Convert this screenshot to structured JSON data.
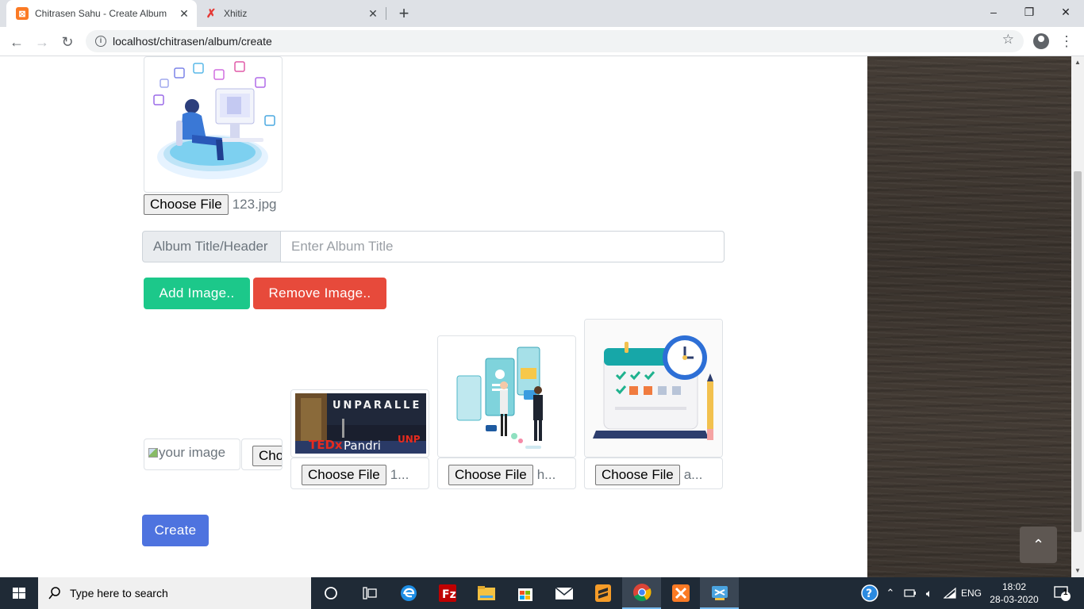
{
  "browser": {
    "tabs": [
      {
        "title": "Chitrasen Sahu - Create Album",
        "favicon": "xampp-icon",
        "active": true
      },
      {
        "title": "Xhitiz",
        "favicon": "x-logo-icon",
        "active": false
      }
    ],
    "new_tab": "+",
    "url": "localhost/chitrasen/album/create",
    "window_controls": {
      "minimize": "–",
      "restore": "❐",
      "close": "✕"
    }
  },
  "form": {
    "cover": {
      "choose_label": "Choose File",
      "filename": "123.jpg"
    },
    "title_input": {
      "prefix": "Album Title/Header",
      "placeholder": "Enter Album Title",
      "value": ""
    },
    "buttons": {
      "add": "Add Image..",
      "remove": "Remove Image..",
      "create": "Create"
    },
    "images": [
      {
        "alt": "your image",
        "choose_label": "Choose File",
        "filename": ""
      },
      {
        "choose_label": "Choose File",
        "filename": "1..."
      },
      {
        "choose_label": "Choose File",
        "filename": "h..."
      },
      {
        "choose_label": "Choose File",
        "filename": "a..."
      }
    ],
    "banner_text": {
      "top": "UNPARALLE",
      "tedx": "TEDx",
      "city": "Pandri",
      "right": "UNP"
    }
  },
  "taskbar": {
    "search_placeholder": "Type here to search",
    "language": "ENG",
    "time": "18:02",
    "date": "28-03-2020",
    "notifications": "1"
  },
  "colors": {
    "add_button": "#1cc88a",
    "remove_button": "#e74a3b",
    "create_button": "#4e73df",
    "sidebar": "#3d3630"
  }
}
